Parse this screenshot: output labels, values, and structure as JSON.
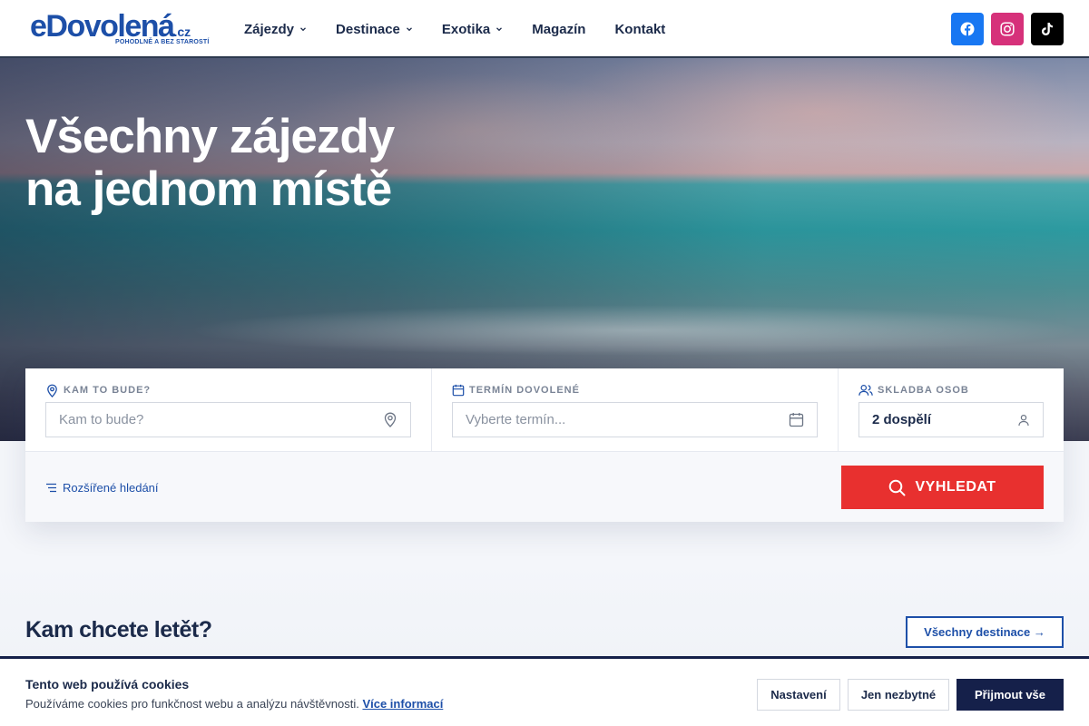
{
  "header": {
    "logo": {
      "brand": "eDovolená",
      "tld": ".cz",
      "tagline": "POHODLNĚ A BEZ STAROSTÍ"
    },
    "nav": [
      {
        "label": "Zájezdy",
        "has_dropdown": true
      },
      {
        "label": "Destinace",
        "has_dropdown": true
      },
      {
        "label": "Exotika",
        "has_dropdown": true
      },
      {
        "label": "Magazín",
        "has_dropdown": false
      },
      {
        "label": "Kontakt",
        "has_dropdown": false
      }
    ],
    "socials": [
      {
        "icon": "facebook-icon",
        "color": "#1877f2"
      },
      {
        "icon": "instagram-icon",
        "color": "#d6317a"
      },
      {
        "icon": "tiktok-icon",
        "color": "#000000"
      }
    ]
  },
  "hero": {
    "title_line1": "Všechny zájezdy",
    "title_line2": "na jednom místě"
  },
  "search": {
    "destination": {
      "label": "KAM TO BUDE?",
      "placeholder": "Kam to bude?"
    },
    "date": {
      "label": "TERMÍN DOVOLENÉ",
      "placeholder": "Vyberte termín..."
    },
    "people": {
      "label": "SKLADBA OSOB",
      "value": "2 dospělí"
    },
    "advanced_label": "Rozšířené hledání",
    "button_label": "VYHLEDAT"
  },
  "destinations": {
    "title": "Kam chcete letět?",
    "all_link": "Všechny destinace →"
  },
  "cookies": {
    "title": " Tento web používá cookies",
    "text": "Používáme cookies pro funkčnost webu a analýzu návštěvnosti.",
    "more_link": "Více informací",
    "settings_label": "Nastavení",
    "necessary_label": "Jen nezbytné",
    "accept_label": "Přijmout vše"
  },
  "colors": {
    "brand": "#1d4fa8",
    "accent": "#e8302f",
    "dark": "#15204a"
  }
}
